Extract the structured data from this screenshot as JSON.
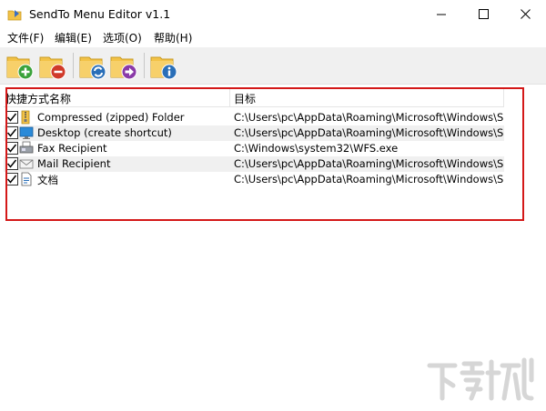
{
  "window": {
    "title": "SendTo Menu Editor v1.1"
  },
  "menu": {
    "items": [
      {
        "label": "文件(F)"
      },
      {
        "label": "编辑(E)"
      },
      {
        "label": "选项(O)"
      },
      {
        "label": "帮助(H)"
      }
    ]
  },
  "toolbar": {
    "buttons": [
      {
        "icon": "folder-add-icon",
        "accent": "#3aa23a"
      },
      {
        "icon": "folder-remove-icon",
        "accent": "#d03a2a"
      },
      {
        "icon": "folder-refresh-icon",
        "accent": "#2a6fb8"
      },
      {
        "icon": "folder-send-icon",
        "accent": "#8a3aa8"
      },
      {
        "icon": "folder-info-icon",
        "accent": "#2a6fb8"
      }
    ]
  },
  "list": {
    "columns": [
      "快捷方式名称",
      "目标"
    ],
    "rows": [
      {
        "checked": true,
        "icon": "zip-folder-icon",
        "name": "Compressed (zipped) Folder",
        "target": "C:\\Users\\pc\\AppData\\Roaming\\Microsoft\\Windows\\SendT..."
      },
      {
        "checked": true,
        "icon": "desktop-icon",
        "name": "Desktop (create shortcut)",
        "target": "C:\\Users\\pc\\AppData\\Roaming\\Microsoft\\Windows\\SendT..."
      },
      {
        "checked": true,
        "icon": "fax-icon",
        "name": "Fax Recipient",
        "target": "C:\\Windows\\system32\\WFS.exe"
      },
      {
        "checked": true,
        "icon": "mail-icon",
        "name": "Mail Recipient",
        "target": "C:\\Users\\pc\\AppData\\Roaming\\Microsoft\\Windows\\SendT..."
      },
      {
        "checked": true,
        "icon": "document-icon",
        "name": "文档",
        "target": "C:\\Users\\pc\\AppData\\Roaming\\Microsoft\\Windows\\SendT..."
      }
    ]
  },
  "colors": {
    "folder": "#f2c247",
    "highlight_border": "#d41818",
    "alt_row": "#f0f0f0"
  }
}
